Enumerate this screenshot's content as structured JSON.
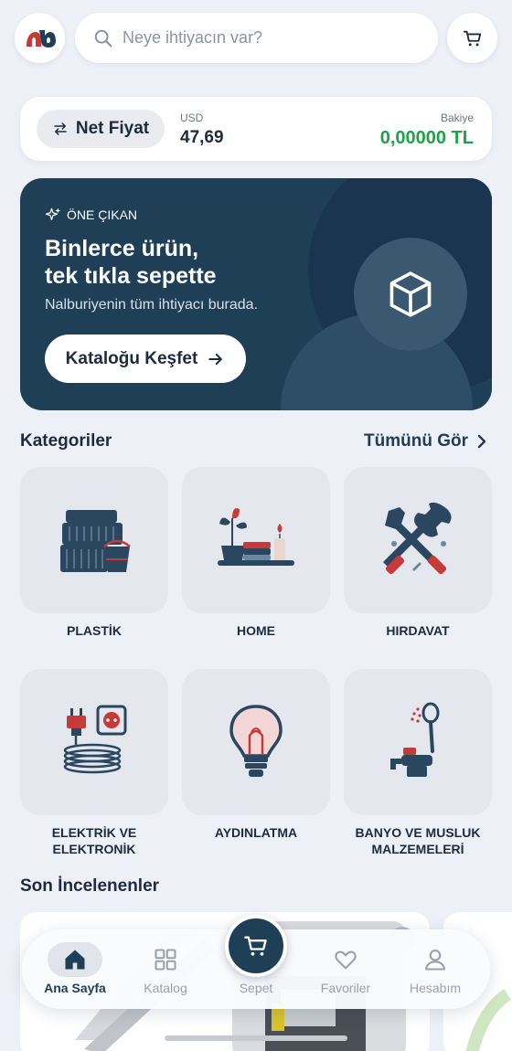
{
  "search": {
    "placeholder": "Neye ihtiyacın var?"
  },
  "price_bar": {
    "toggle_label": "Net Fiyat",
    "currency_label": "USD",
    "currency_value": "47,69",
    "balance_label": "Bakiye",
    "balance_value": "0,00000 TL",
    "balance_color": "#1fa34a"
  },
  "hero": {
    "badge": "ÖNE ÇIKAN",
    "headline_line1": "Binlerce ürün,",
    "headline_line2": "tek tıkla sepette",
    "subtitle": "Nalburiyenin tüm ihtiyacı burada.",
    "cta_label": "Kataloğu Keşfet",
    "background_color": "#1f3f57"
  },
  "categories": {
    "title": "Kategoriler",
    "see_all": "Tümünü Gör",
    "items": [
      {
        "label": "PLASTİK",
        "icon": "plastic-baskets-icon"
      },
      {
        "label": "HOME",
        "icon": "home-decor-icon"
      },
      {
        "label": "HIRDAVAT",
        "icon": "tools-icon"
      },
      {
        "label": "ELEKTRİK VE\nELEKTRONİK",
        "icon": "plug-cable-icon"
      },
      {
        "label": "AYDINLATMA",
        "icon": "light-bulb-icon"
      },
      {
        "label": "BANYO VE MUSLUK\nMALZEMELERİ",
        "icon": "faucet-shower-icon"
      }
    ]
  },
  "recent": {
    "title": "Son İncelenenler"
  },
  "bottom_nav": {
    "items": [
      {
        "label": "Ana Sayfa",
        "icon": "home-icon",
        "active": true
      },
      {
        "label": "Katalog",
        "icon": "grid-icon",
        "active": false
      },
      {
        "label": "Sepet",
        "icon": "cart-icon",
        "active": false
      },
      {
        "label": "Favoriler",
        "icon": "heart-icon",
        "active": false
      },
      {
        "label": "Hesabım",
        "icon": "user-icon",
        "active": false
      }
    ]
  },
  "colors": {
    "accent": "#1f3f57",
    "brand_red": "#c63a3a",
    "background": "#eef0f7"
  }
}
